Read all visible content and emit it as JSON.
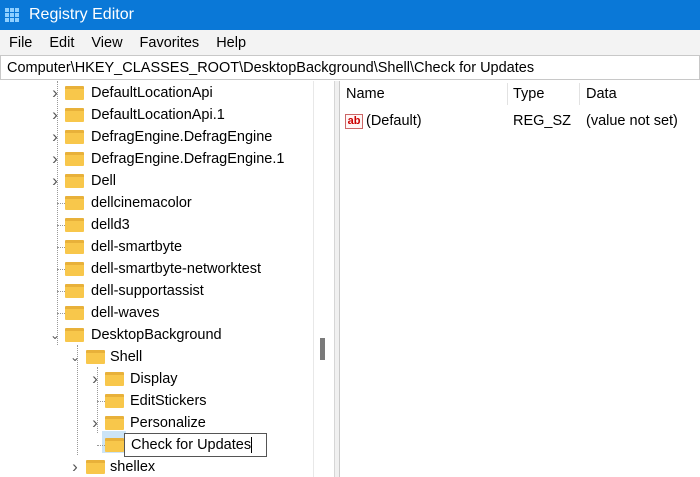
{
  "window": {
    "title": "Registry Editor"
  },
  "menu": [
    "File",
    "Edit",
    "View",
    "Favorites",
    "Help"
  ],
  "address": "Computer\\HKEY_CLASSES_ROOT\\DesktopBackground\\Shell\\Check for Updates",
  "tree": [
    {
      "label": "DefaultLocationApi",
      "level": 1,
      "expander": "collapsed"
    },
    {
      "label": "DefaultLocationApi.1",
      "level": 1,
      "expander": "collapsed"
    },
    {
      "label": "DefragEngine.DefragEngine",
      "level": 1,
      "expander": "collapsed"
    },
    {
      "label": "DefragEngine.DefragEngine.1",
      "level": 1,
      "expander": "collapsed"
    },
    {
      "label": "Dell",
      "level": 1,
      "expander": "collapsed"
    },
    {
      "label": "dellcinemacolor",
      "level": 1,
      "expander": "none"
    },
    {
      "label": "delld3",
      "level": 1,
      "expander": "none"
    },
    {
      "label": "dell-smartbyte",
      "level": 1,
      "expander": "none"
    },
    {
      "label": "dell-smartbyte-networktest",
      "level": 1,
      "expander": "none"
    },
    {
      "label": "dell-supportassist",
      "level": 1,
      "expander": "none"
    },
    {
      "label": "dell-waves",
      "level": 1,
      "expander": "none"
    },
    {
      "label": "DesktopBackground",
      "level": 1,
      "expander": "expanded"
    },
    {
      "label": "Shell",
      "level": 2,
      "expander": "expanded"
    },
    {
      "label": "Display",
      "level": 3,
      "expander": "collapsed"
    },
    {
      "label": "EditStickers",
      "level": 3,
      "expander": "none"
    },
    {
      "label": "Personalize",
      "level": 3,
      "expander": "collapsed"
    },
    {
      "label": "",
      "level": 3,
      "expander": "none",
      "selected": true
    },
    {
      "label": "shellex",
      "level": 2,
      "expander": "collapsed"
    }
  ],
  "rename_value": "Check for Updates",
  "values": {
    "headers": {
      "name": "Name",
      "type": "Type",
      "data": "Data"
    },
    "rows": [
      {
        "name": "(Default)",
        "type": "REG_SZ",
        "data": "(value not set)",
        "icon": "ab"
      }
    ]
  }
}
